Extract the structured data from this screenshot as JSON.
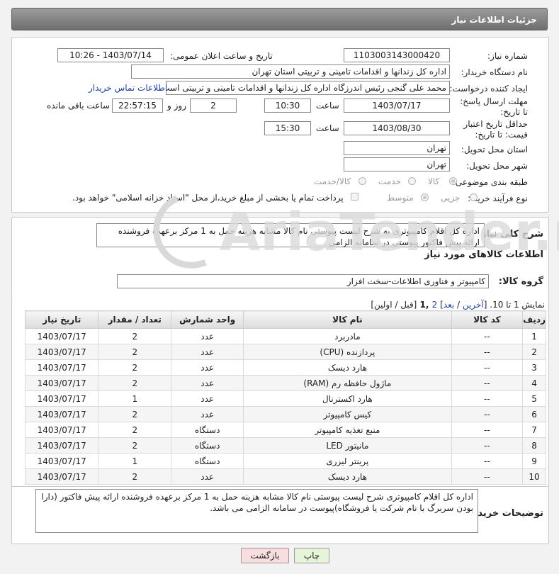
{
  "page_title": "جزئیات اطلاعات نیاز",
  "fields": {
    "need_number_label": "شماره نیاز:",
    "need_number": "1103003143000420",
    "announce_label": "تاریخ و ساعت اعلان عمومی:",
    "announce_value": "1403/07/14 - 10:26",
    "buyer_org_label": "نام دستگاه خریدار:",
    "buyer_org": "اداره کل زندانها و اقدامات تامینی و تربیتی استان تهران",
    "creator_label": "ایجاد کننده درخواست:",
    "creator": "محمد علی گنجی رئیس اندرزگاه  اداره کل زندانها و اقدامات تامینی و تربیتی است",
    "contact_link": "اطلاعات تماس خریدار",
    "deadline_label": "مهلت ارسال پاسخ: تا تاریخ:",
    "deadline_date": "1403/07/17",
    "time_word": "ساعت",
    "deadline_time": "10:30",
    "days_value": "2",
    "days_word": "روز و",
    "remaining_time": "22:57:15",
    "remaining_word": "ساعت باقی مانده",
    "validity_label": "حداقل تاریخ اعتبار قیمت: تا تاریخ:",
    "validity_date": "1403/08/30",
    "validity_time": "15:30",
    "province_label": "استان محل تحویل:",
    "province": "تهران",
    "city_label": "شهر محل تحویل:",
    "city": "تهران",
    "category_label": "طبقه بندی موضوعی:",
    "category_options": [
      "کالا",
      "خدمت",
      "کالا/خدمت"
    ],
    "process_label": "نوع فرآیند خرید :",
    "process_options": [
      "جزیی",
      "متوسط"
    ],
    "payment_note": "پرداخت تمام یا بخشی از مبلغ خرید،از محل \"اسناد خزانه اسلامی\" خواهد بود."
  },
  "description": {
    "label": "شرح کلی نیاز:",
    "text": "اداره کل اقلام کامپیوتری به شرح لیست پیوستی نام کالا مشابه هزینه حمل به 1 مرکز برعهده فروشنده ارائه پیش فاکتور پیوستی در سامانه الزامی"
  },
  "goods_section": {
    "title": "اطلاعات کالاهای مورد نیاز",
    "group_label": "گروه کالا:",
    "group_value": "کامپیوتر و فناوری اطلاعات-سخت افزار"
  },
  "pagination": {
    "prefix": "نمایش 1 تا 10. [",
    "last": "آخرین",
    "sep1": " / ",
    "next": "بعد",
    "bracket_close": "] ",
    "page2": "2",
    "current": " ,1 ",
    "tail": "[قبل / اولین]"
  },
  "table": {
    "headers": [
      "ردیف",
      "کد کالا",
      "نام کالا",
      "واحد شمارش",
      "تعداد / مقدار",
      "تاریخ نیاز"
    ],
    "rows": [
      [
        "1",
        "--",
        "مادربرد",
        "عدد",
        "2",
        "1403/07/17"
      ],
      [
        "2",
        "--",
        "پردازنده (CPU)",
        "عدد",
        "2",
        "1403/07/17"
      ],
      [
        "3",
        "--",
        "هارد دیسک",
        "عدد",
        "2",
        "1403/07/17"
      ],
      [
        "4",
        "--",
        "ماژول حافظه رم (RAM)",
        "عدد",
        "2",
        "1403/07/17"
      ],
      [
        "5",
        "--",
        "هارد اکسترنال",
        "عدد",
        "1",
        "1403/07/17"
      ],
      [
        "6",
        "--",
        "کیس کامپیوتر",
        "عدد",
        "2",
        "1403/07/17"
      ],
      [
        "7",
        "--",
        "منبع تغذیه کامپیوتر",
        "دستگاه",
        "2",
        "1403/07/17"
      ],
      [
        "8",
        "--",
        "مانیتور LED",
        "دستگاه",
        "2",
        "1403/07/17"
      ],
      [
        "9",
        "--",
        "پرینتر لیزری",
        "دستگاه",
        "1",
        "1403/07/17"
      ],
      [
        "10",
        "--",
        "هارد دیسک",
        "عدد",
        "2",
        "1403/07/17"
      ]
    ]
  },
  "buyer_notes": {
    "label": "توضیحات خریدار:",
    "text": "اداره کل اقلام کامپیوتری  شرح لیست پیوستی نام کالا مشابه هزینه حمل به 1 مرکز برعهده فروشنده ارائه پیش فاکتور (دارا بودن سربرگ با نام شرکت یا فروشگاه)پیوست در سامانه الزامی می باشد."
  },
  "buttons": {
    "print": "چاپ",
    "back": "بازگشت"
  },
  "watermark_text": "AriaTender.neT",
  "colors": {
    "header_bar": "#7d7d7d",
    "link": "#1a3fb0",
    "print_btn": "#e6f5d8",
    "back_btn": "#f8dede",
    "watermark": "#d6d6d6"
  }
}
